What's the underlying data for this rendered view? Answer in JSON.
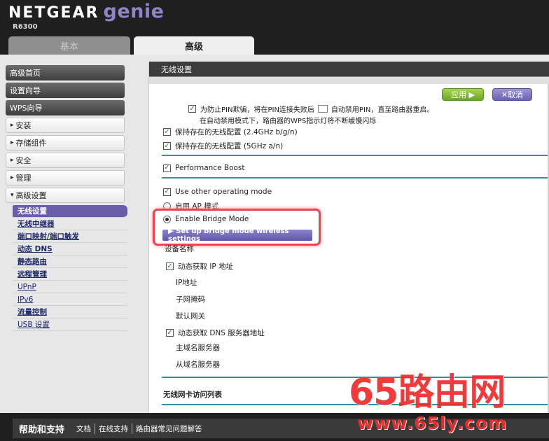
{
  "header": {
    "brand_main": "NETGEAR",
    "brand_genie": "genie",
    "model": "R6300",
    "tabs": [
      {
        "label": "基本"
      },
      {
        "label": "高级"
      }
    ]
  },
  "sidebar": {
    "items": [
      {
        "label": "高级首页"
      },
      {
        "label": "设置向导"
      },
      {
        "label": "WPS向导"
      },
      {
        "label": "安装"
      },
      {
        "label": "存储组件"
      },
      {
        "label": "安全"
      },
      {
        "label": "管理"
      },
      {
        "label": "高级设置"
      }
    ],
    "expand_arrow": "▸",
    "collapse_arrow": "▾",
    "subitems": [
      {
        "label": "无线设置"
      },
      {
        "label": "无线中继器"
      },
      {
        "label": "端口映射/端口触发"
      },
      {
        "label": "动态 DNS"
      },
      {
        "label": "静态路由"
      },
      {
        "label": "远程管理"
      },
      {
        "label": "UPnP"
      },
      {
        "label": "IPv6"
      },
      {
        "label": "流量控制"
      },
      {
        "label": "USB 设置"
      }
    ]
  },
  "panel": {
    "title": "无线设置",
    "apply_label": "应用 ▶",
    "cancel_label": "✕取消",
    "pin_text_line1": "为防止PIN欺骗，将在PIN连接失败后",
    "pin_text_line1b": "自动禁用PIN，直至路由器重启。",
    "pin_text_line2": "在自动禁用模式下，路由器的WPS指示灯将不断缓慢闪烁",
    "keep_24": "保持存在的无线配置 (2.4GHz b/g/n)",
    "keep_5": "保持存在的无线配置 (5GHz a/n)",
    "performance_boost": "Performance Boost",
    "other_mode": "Use other operating mode",
    "ap_mode": "启用 AP 模式",
    "bridge_mode": "Enable Bridge Mode",
    "bridge_button": "▶ Set up bridge mode wireless settings",
    "device_name": "设备名称",
    "auto_ip": "动态获取 IP 地址",
    "ip_address": "IP地址",
    "subnet_mask": "子网掩码",
    "gateway": "默认网关",
    "auto_dns": "动态获取 DNS 服务器地址",
    "primary_dns": "主域名服务器",
    "secondary_dns": "从域名服务器",
    "mac_list": "无线网卡访问列表",
    "checkmark": "✓"
  },
  "footer": {
    "title": "帮助和支持",
    "links": [
      "文档",
      "在线支持",
      "路由器常见问题解答"
    ]
  },
  "watermark": {
    "big": "65路由网",
    "url": "www.65ly.com"
  }
}
